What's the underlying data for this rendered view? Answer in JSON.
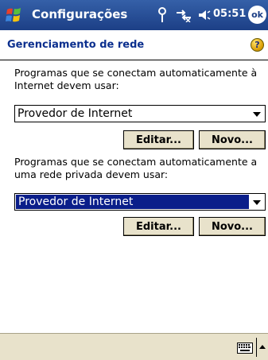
{
  "titlebar": {
    "app_title": "Configurações",
    "clock": "05:51",
    "ok_label": "ok"
  },
  "header": {
    "title": "Gerenciamento de rede",
    "help_label": "?"
  },
  "internet_section": {
    "prompt": "Programas que se conectam automaticamente à Internet devem usar:",
    "selected_value": "Provedor de Internet",
    "edit_label": "Editar...",
    "new_label": "Novo..."
  },
  "private_section": {
    "prompt": "Programas que se conectam automaticamente a uma rede privada devem usar:",
    "selected_value": "Provedor de Internet",
    "edit_label": "Editar...",
    "new_label": "Novo..."
  },
  "colors": {
    "titlebar": "#1c3f86",
    "accent_text": "#0b2f8e",
    "selection": "#0a1e8a",
    "button_face": "#e8e2cb"
  },
  "icons": [
    "windows-flag-icon",
    "antenna-icon",
    "connectivity-icon",
    "speaker-icon",
    "help-icon",
    "keyboard-icon"
  ]
}
